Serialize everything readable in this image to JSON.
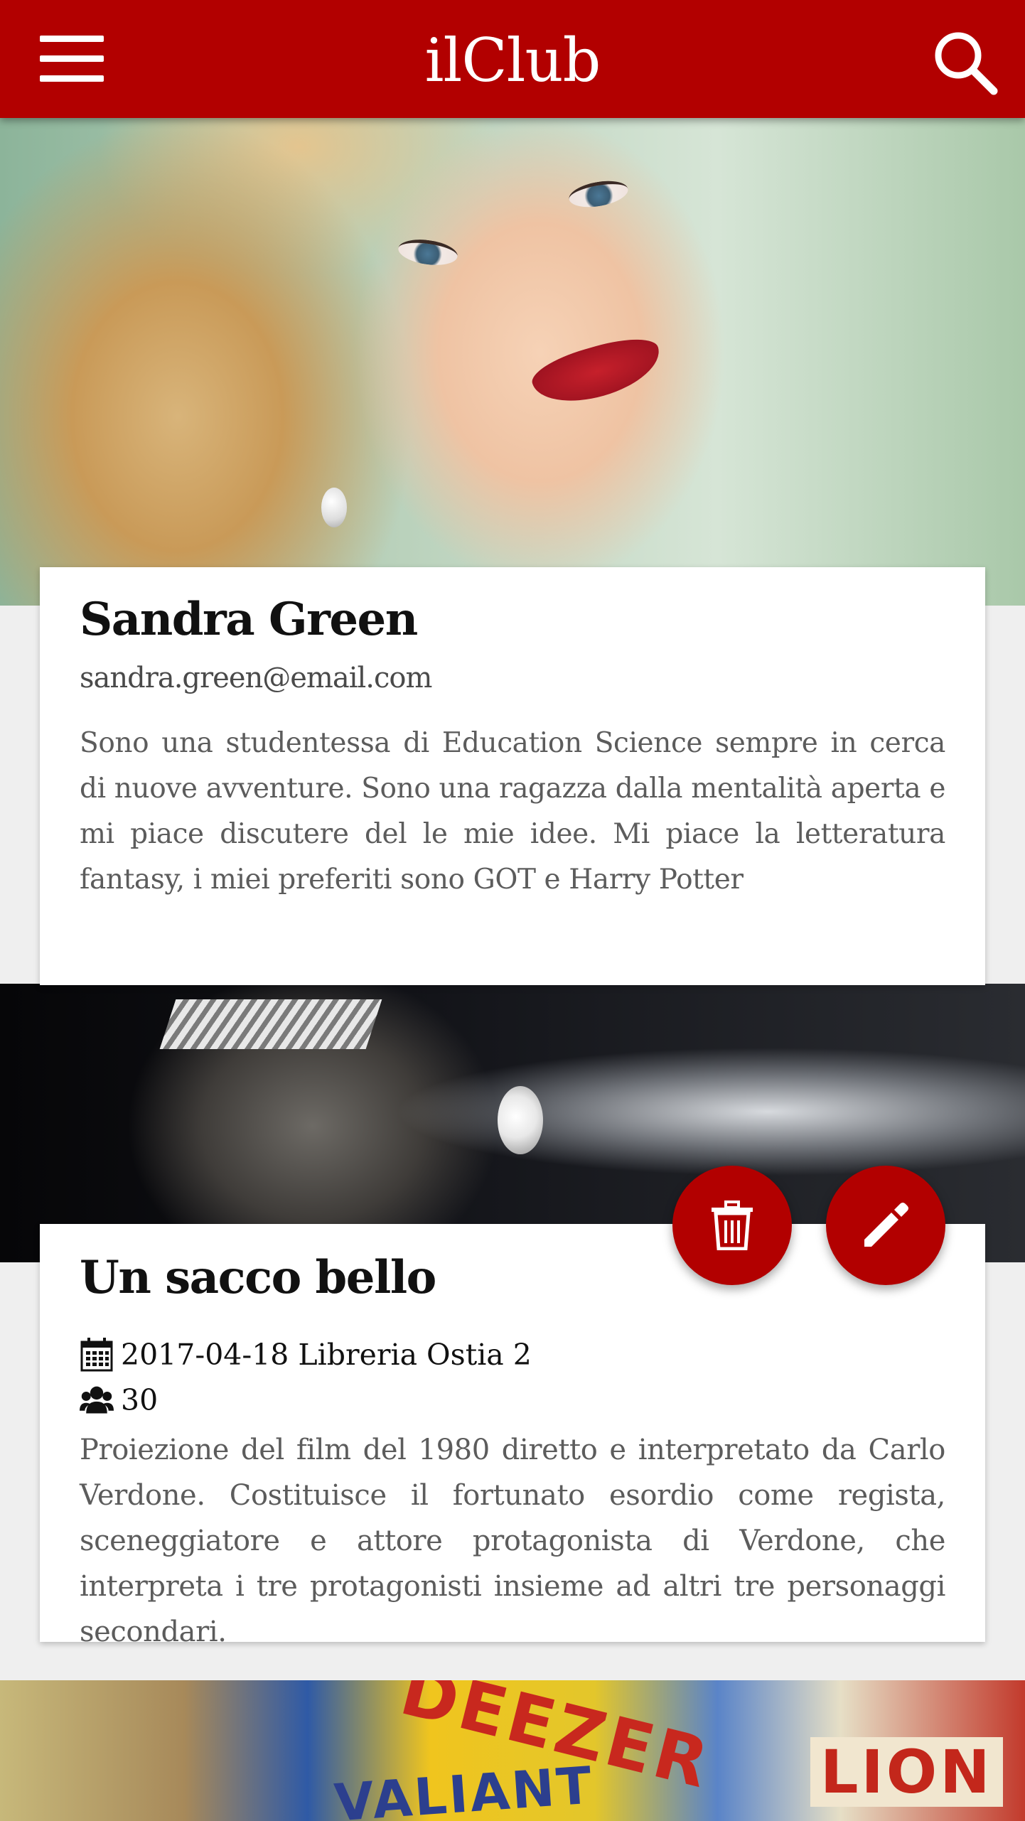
{
  "app": {
    "title": "ilClub"
  },
  "icons": {
    "menu": "hamburger-menu-icon",
    "search": "search-icon",
    "delete": "trash-icon",
    "edit": "pencil-icon",
    "date": "calendar-icon",
    "participants": "users-icon"
  },
  "colors": {
    "primary": "#b20000",
    "background": "#efefef",
    "card": "#ffffff"
  },
  "profile": {
    "name": "Sandra Green",
    "email": "sandra.green@email.com",
    "bio": "Sono una studentessa di Education Science sempre in cerca di nuove avventure. Sono una ragazza dalla mentalità aperta e mi piace discutere del le mie idee. Mi piace la letteratura fantasy, i miei preferiti sono GOT e Harry Potter"
  },
  "event": {
    "title": "Un sacco bello",
    "date_place": "2017-04-18 Libreria Ostia 2",
    "participants": "30",
    "description": "Proiezione del film del 1980 diretto e interpretato da Carlo Verdone. Costituisce il fortunato esordio come regista, sceneggiatore e attore protagonista di Verdone, che interpreta i tre protagonisti insieme ad altri tre personaggi secondari."
  }
}
